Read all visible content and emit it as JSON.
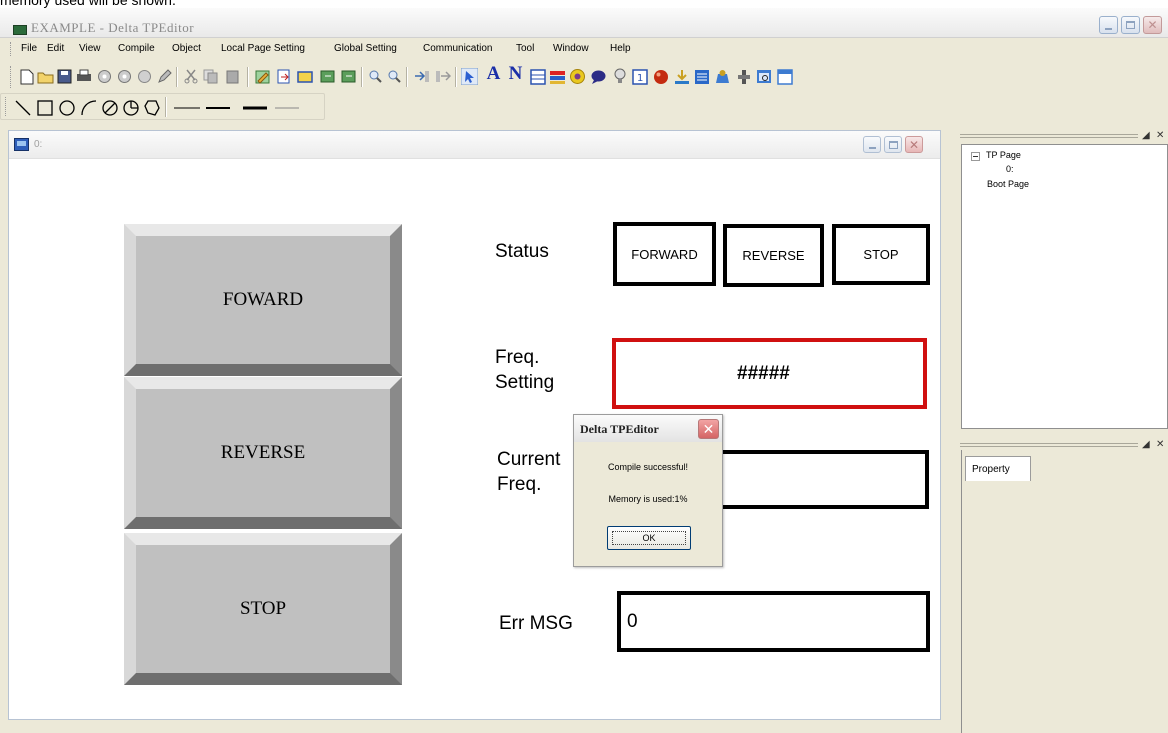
{
  "caption": "memory used will be shown.",
  "app": {
    "title": "EXAMPLE - Delta TPEditor"
  },
  "menu": [
    "File",
    "Edit",
    "View",
    "Compile",
    "Object",
    "Local Page Setting",
    "Global Setting",
    "Communication",
    "Tool",
    "Window",
    "Help"
  ],
  "toolbar": {
    "text_tool": "A",
    "numeric_tool": "N"
  },
  "child_window": {
    "title": "0:"
  },
  "buttons": {
    "forward": "FOWARD",
    "reverse": "REVERSE",
    "stop": "STOP"
  },
  "labels": {
    "status": "Status",
    "freq_setting_1": "Freq.",
    "freq_setting_2": "Setting",
    "current_freq_1": "Current",
    "current_freq_2": "Freq.",
    "err_msg": "Err MSG"
  },
  "status_indicators": [
    "FORWARD",
    "REVERSE",
    "STOP"
  ],
  "fields": {
    "freq_setting_value": "#####",
    "current_freq_value": "",
    "err_msg_value": "0"
  },
  "dialog": {
    "title": "Delta TPEditor",
    "message": "Compile successful!",
    "memory": "Memory is used:1%",
    "ok_label": "OK"
  },
  "tree": {
    "root": "TP Page",
    "child": "0:",
    "boot": "Boot Page"
  },
  "property": {
    "tab_label": "Property"
  },
  "colors": {
    "frame": "#ece9d8",
    "button_face": "#c0c0c0",
    "freq_border": "#d01010"
  }
}
